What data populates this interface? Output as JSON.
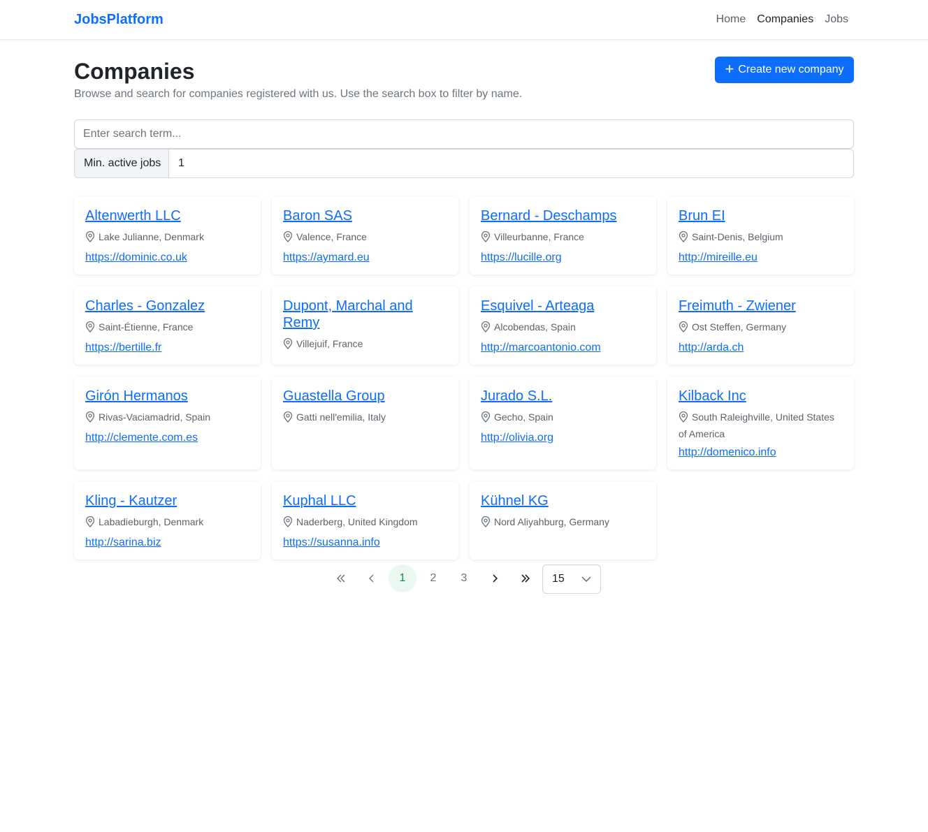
{
  "nav": {
    "brand": "JobsPlatform",
    "links": [
      "Home",
      "Companies",
      "Jobs"
    ],
    "active": "Companies"
  },
  "header": {
    "title": "Companies",
    "description": "Browse and search for companies registered with us. Use the search box to filter by name.",
    "create_button": "Create new company"
  },
  "filters": {
    "search_placeholder": "Enter search term...",
    "search_value": "",
    "min_jobs_label": "Min. active jobs",
    "min_jobs_value": "1"
  },
  "companies": [
    {
      "name": "Altenwerth LLC",
      "location": "Lake Julianne, Denmark",
      "url": "https://dominic.co.uk"
    },
    {
      "name": "Baron SAS",
      "location": "Valence, France",
      "url": "https://aymard.eu"
    },
    {
      "name": "Bernard - Deschamps",
      "location": "Villeurbanne, France",
      "url": "https://lucille.org"
    },
    {
      "name": "Brun EI",
      "location": "Saint-Denis, Belgium",
      "url": "http://mireille.eu"
    },
    {
      "name": "Charles - Gonzalez",
      "location": "Saint-Étienne, France",
      "url": "https://bertille.fr"
    },
    {
      "name": "Dupont, Marchal and Remy",
      "location": "Villejuif, France",
      "url": ""
    },
    {
      "name": "Esquivel - Arteaga",
      "location": "Alcobendas, Spain",
      "url": "http://marcoantonio.com"
    },
    {
      "name": "Freimuth - Zwiener",
      "location": "Ost Steffen, Germany",
      "url": "http://arda.ch"
    },
    {
      "name": "Girón Hermanos",
      "location": "Rivas-Vaciamadrid, Spain",
      "url": "http://clemente.com.es"
    },
    {
      "name": "Guastella Group",
      "location": "Gatti nell'emilia, Italy",
      "url": ""
    },
    {
      "name": "Jurado S.L.",
      "location": "Gecho, Spain",
      "url": "http://olivia.org"
    },
    {
      "name": "Kilback Inc",
      "location": "South Raleighville, United States of America",
      "url": "http://domenico.info"
    },
    {
      "name": "Kling - Kautzer",
      "location": "Labadieburgh, Denmark",
      "url": "http://sarina.biz"
    },
    {
      "name": "Kuphal LLC",
      "location": "Naderberg, United Kingdom",
      "url": "https://susanna.info"
    },
    {
      "name": "Kühnel KG",
      "location": "Nord Aliyahburg, Germany",
      "url": ""
    }
  ],
  "pagination": {
    "first": "«",
    "prev": "‹",
    "pages": [
      "1",
      "2",
      "3"
    ],
    "current": "1",
    "next": "›",
    "last": "»",
    "page_size": "15"
  },
  "colors": {
    "primary": "#0d6efd",
    "active_page_bg": "#e9f9f1",
    "active_page_text": "#198754"
  }
}
